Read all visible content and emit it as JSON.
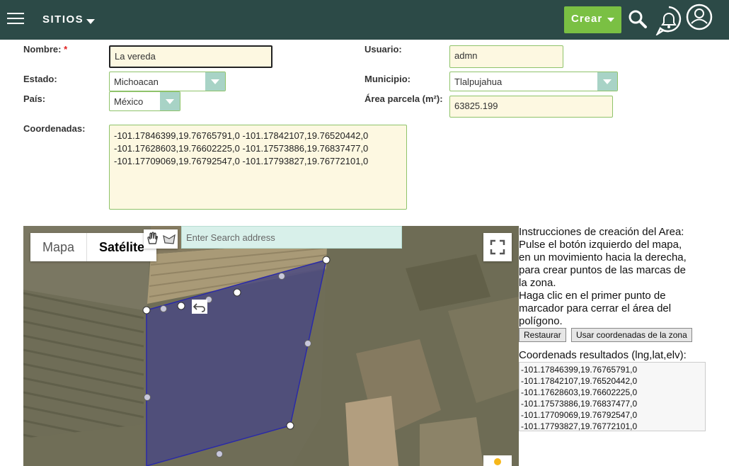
{
  "header": {
    "sites_label": "SITIOS",
    "create_label": "Crear"
  },
  "form": {
    "nombre_label": "Nombre:",
    "required_mark": "*",
    "nombre_value": "La vereda",
    "usuario_label": "Usuario:",
    "usuario_value": "admn",
    "estado_label": "Estado:",
    "estado_value": "Michoacan",
    "municipio_label": "Municipio:",
    "municipio_value": "Tlalpujahua",
    "pais_label": "País:",
    "pais_value": "México",
    "area_label": "Área parcela (m²):",
    "area_value": "63825.199",
    "coords_label": "Coordenadas:",
    "coords_lines": [
      "-101.17846399,19.76765791,0 -101.17842107,19.76520442,0",
      "-101.17628603,19.76602225,0 -101.17573886,19.76837477,0",
      "-101.17709069,19.76792547,0 -101.17793827,19.76772101,0"
    ]
  },
  "map": {
    "type_map": "Mapa",
    "type_satellite": "Satélite",
    "search_placeholder": "Enter Search address"
  },
  "instructions": {
    "lines": [
      "Instrucciones de creación del Area:",
      "Pulse el botón izquierdo del mapa,",
      "en un movimiento hacia la derecha,",
      "para crear puntos de las marcas de",
      "la zona.",
      "Haga clic en el primer punto de",
      "marcador para cerrar el área del",
      "polígono."
    ],
    "restore_label": "Restaurar",
    "use_coords_label": "Usar coordenadas de la zona"
  },
  "results": {
    "title": "Coordenads resultados (lng,lat,elv):",
    "coords": [
      "-101.17846399,19.76765791,0",
      "-101.17842107,19.76520442,0",
      "-101.17628603,19.76602225,0",
      "-101.17573886,19.76837477,0",
      "-101.17709069,19.76792547,0",
      "-101.17793827,19.76772101,0"
    ]
  }
}
